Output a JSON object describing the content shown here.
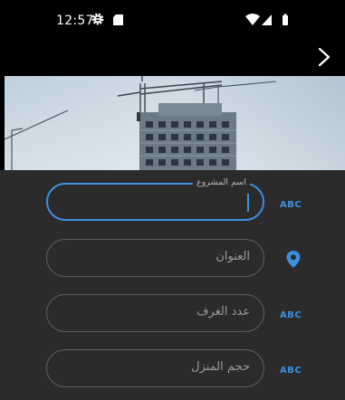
{
  "status_bar": {
    "time": "12:57",
    "icons": [
      "settings-gear-icon",
      "sd-card-icon",
      "wifi-icon",
      "signal-icon",
      "battery-icon"
    ]
  },
  "toolbar": {
    "forward_icon": "chevron-right-icon"
  },
  "hero": {
    "image": "construction-site-with-cranes"
  },
  "form": {
    "fields": [
      {
        "label": "اسم المشروع",
        "value": "",
        "icon": "abc-text-icon",
        "state": "focused"
      },
      {
        "placeholder": "العنوان",
        "icon": "location-pin-icon"
      },
      {
        "placeholder": "عدد الغرف",
        "icon": "abc-text-icon"
      },
      {
        "placeholder": "حجم المنزل",
        "icon": "abc-text-icon"
      }
    ]
  },
  "colors": {
    "accent": "#3d8fe0",
    "form_background": "#2b2b2b",
    "status_background": "#000000",
    "field_border": "#5e5e5e"
  }
}
